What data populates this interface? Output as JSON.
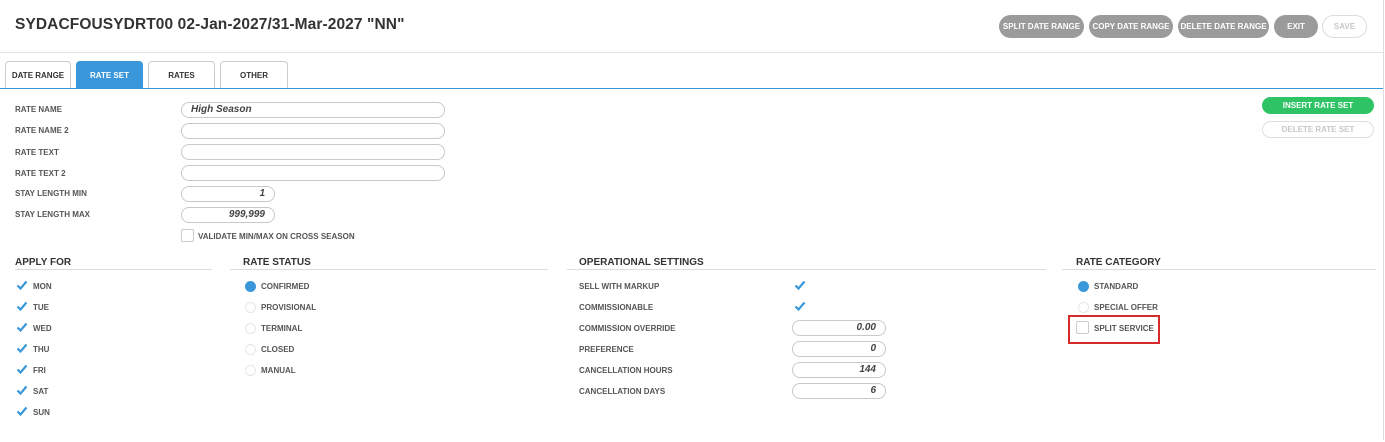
{
  "header": {
    "title": "SYDACFOUSYDRT00 02-Jan-2027/31-Mar-2027 \"NN\"",
    "buttons": {
      "split": "SPLIT DATE RANGE",
      "copy": "COPY DATE RANGE",
      "delete": "DELETE DATE RANGE",
      "exit": "EXIT",
      "save": "SAVE"
    }
  },
  "tabs": [
    "DATE RANGE",
    "RATE SET",
    "RATES",
    "OTHER"
  ],
  "form": {
    "rate_name_label": "RATE NAME",
    "rate_name": "High Season",
    "rate_name2_label": "RATE NAME 2",
    "rate_name2": "",
    "rate_text_label": "RATE TEXT",
    "rate_text": "",
    "rate_text2_label": "RATE TEXT 2",
    "rate_text2": "",
    "stay_min_label": "STAY LENGTH MIN",
    "stay_min": "1",
    "stay_max_label": "STAY LENGTH MAX",
    "stay_max": "999,999",
    "validate_label": "VALIDATE MIN/MAX ON CROSS SEASON"
  },
  "actions": {
    "insert": "INSERT RATE SET",
    "delete": "DELETE RATE SET"
  },
  "apply_for": {
    "title": "APPLY FOR",
    "days": [
      "MON",
      "TUE",
      "WED",
      "THU",
      "FRI",
      "SAT",
      "SUN"
    ]
  },
  "rate_status": {
    "title": "RATE STATUS",
    "options": [
      "CONFIRMED",
      "PROVISIONAL",
      "TERMINAL",
      "CLOSED",
      "MANUAL"
    ],
    "selected": "CONFIRMED"
  },
  "operational": {
    "title": "OPERATIONAL SETTINGS",
    "sell_with_markup": "SELL WITH MARKUP",
    "commissionable": "COMMISSIONABLE",
    "commission_override_label": "COMMISSION OVERRIDE",
    "commission_override": "0.00",
    "preference_label": "PREFERENCE",
    "preference": "0",
    "cancel_hours_label": "CANCELLATION HOURS",
    "cancel_hours": "144",
    "cancel_days_label": "CANCELLATION DAYS",
    "cancel_days": "6"
  },
  "rate_category": {
    "title": "RATE CATEGORY",
    "standard": "STANDARD",
    "special_offer": "SPECIAL OFFER",
    "split_service": "SPLIT SERVICE",
    "selected": "STANDARD"
  },
  "colors": {
    "accent": "#3a97d9",
    "insert": "#2ec466",
    "button_grey": "#9b9b9b",
    "highlight": "#d42a2a"
  }
}
